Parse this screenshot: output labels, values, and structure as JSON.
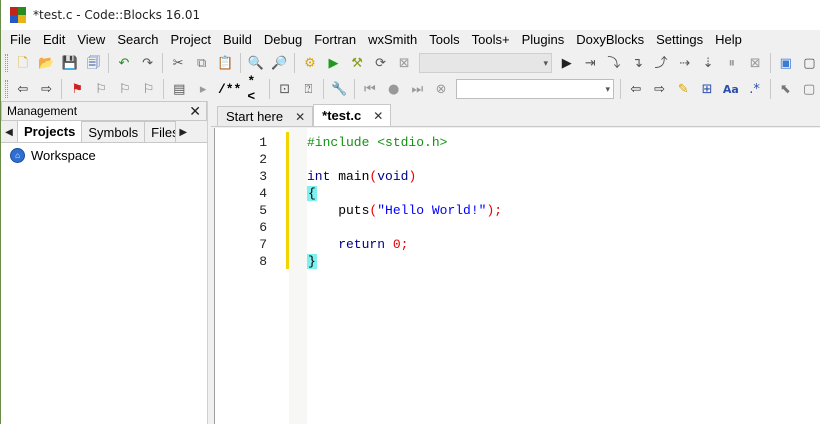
{
  "window": {
    "title": "*test.c - Code::Blocks 16.01",
    "icon_colors": [
      "#c0241a",
      "#2b8a1e",
      "#2658c4",
      "#e8b219"
    ]
  },
  "menu": [
    "File",
    "Edit",
    "View",
    "Search",
    "Project",
    "Build",
    "Debug",
    "Fortran",
    "wxSmith",
    "Tools",
    "Tools+",
    "Plugins",
    "DoxyBlocks",
    "Settings",
    "Help"
  ],
  "toolbar2": {
    "doxy_block": "/**",
    "doxy_line": "*<"
  },
  "management": {
    "title": "Management",
    "tabs": [
      "Projects",
      "Symbols",
      "Files"
    ],
    "active_tab": "Projects",
    "tree": [
      "Workspace"
    ]
  },
  "editor": {
    "tabs": [
      {
        "label": "Start here",
        "active": false
      },
      {
        "label": "*test.c",
        "active": true
      }
    ],
    "line_numbers": [
      "1",
      "2",
      "3",
      "4",
      "5",
      "6",
      "7",
      "8"
    ],
    "code": {
      "l1": "#include <stdio.h>",
      "l3_type": "int",
      "l3_name": " main",
      "l3_open": "(",
      "l3_param": "void",
      "l3_close": ")",
      "l4": "{",
      "l5_fn": "    puts",
      "l5_open": "(",
      "l5_str": "\"Hello World!\"",
      "l5_close": ")",
      "l5_semi": ";",
      "l7_kw": "    return",
      "l7_num": "0",
      "l7_semi": ";",
      "l8": "}"
    },
    "colors": {
      "preprocessor": "#139313",
      "keyword": "#00008b",
      "string": "#0000ff",
      "number": "#e00000",
      "change_bar": "#f2d400",
      "brace_match": "#7ff0f0"
    }
  }
}
